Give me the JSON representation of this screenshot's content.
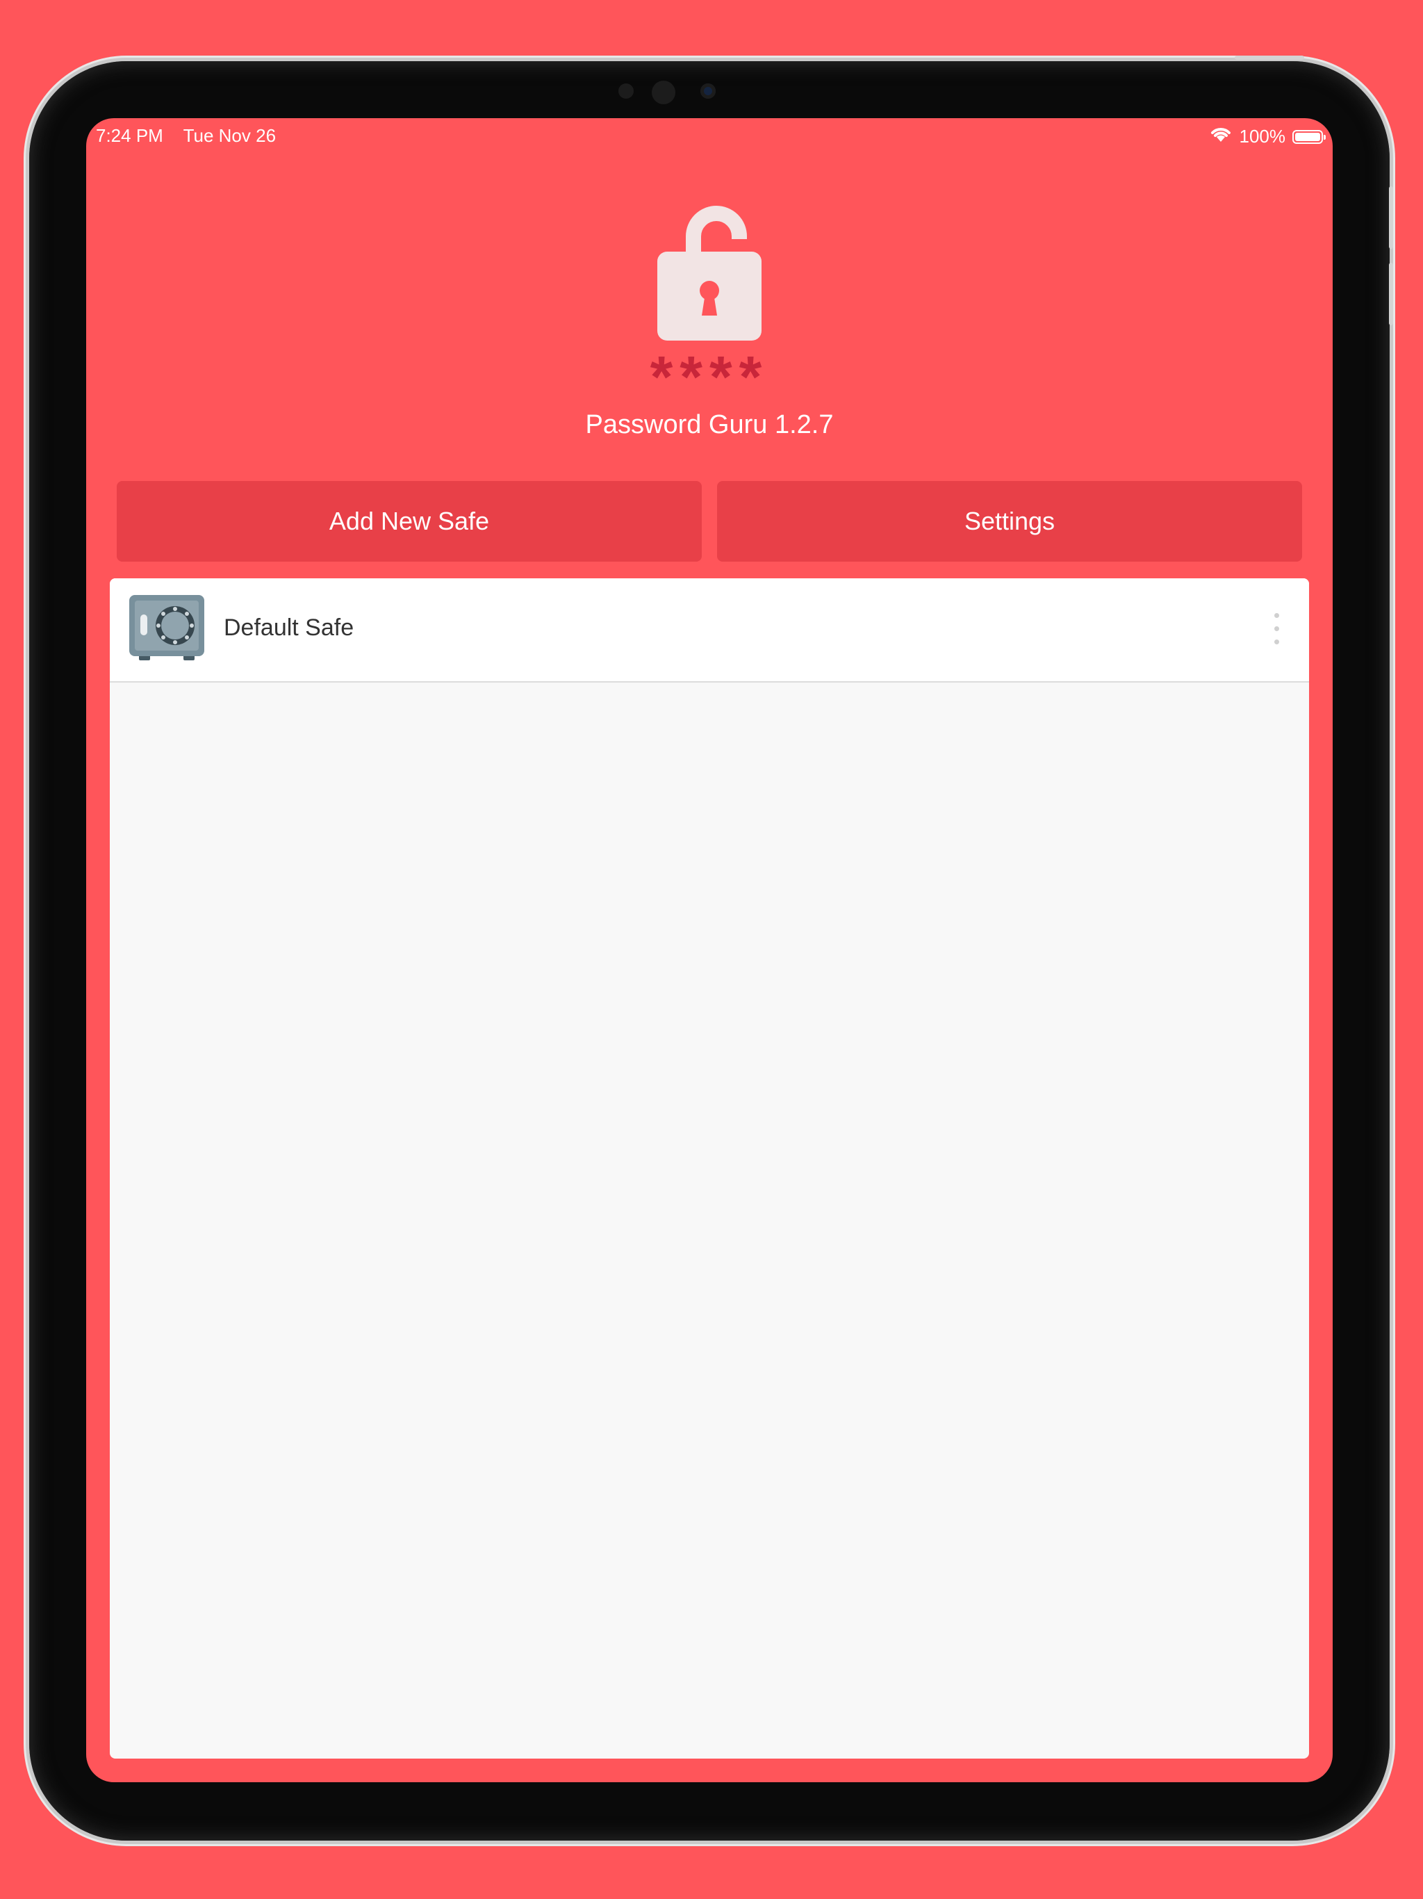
{
  "status_bar": {
    "time": "7:24 PM",
    "date": "Tue Nov 26",
    "battery": "100%",
    "battery_level": 1.0
  },
  "header": {
    "mask": "****",
    "title": "Password Guru 1.2.7"
  },
  "actions": {
    "add_label": "Add New Safe",
    "settings_label": "Settings"
  },
  "safes": [
    {
      "name": "Default Safe",
      "icon": "safe-icon"
    }
  ],
  "icons": {
    "lock": "unlocked-padlock-icon",
    "more": "more-vertical-icon",
    "wifi": "wifi-icon",
    "battery": "battery-icon"
  },
  "colors": {
    "background": "#ff555a",
    "button": "#e84048",
    "mask": "#c8263a",
    "lock": "#f2e4e4",
    "list_bg": "#f8f8f8"
  }
}
